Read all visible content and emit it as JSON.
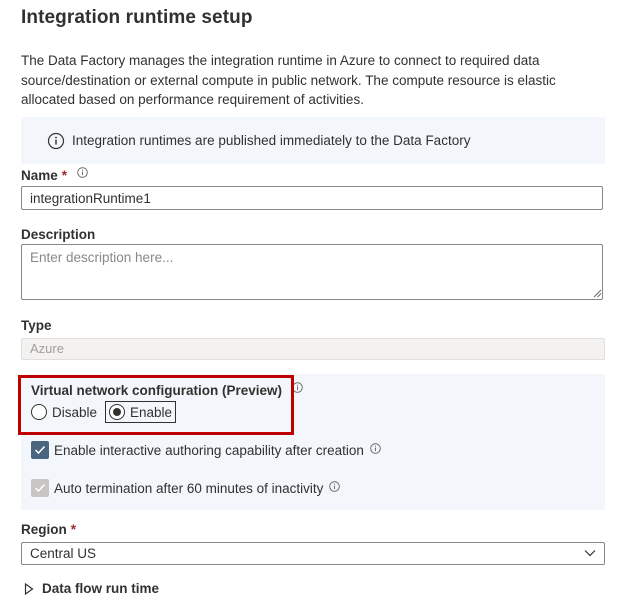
{
  "header": {
    "title": "Integration runtime setup"
  },
  "intro": {
    "text": "The Data Factory manages the integration runtime in Azure to connect to required data source/destination or external compute in public network. The compute resource is elastic allocated based on performance requirement of activities."
  },
  "info_banner": {
    "icon": "info-icon",
    "text": "Integration runtimes are published immediately to the Data Factory"
  },
  "form": {
    "name": {
      "label": "Name",
      "required_mark": "*",
      "value": "integrationRuntime1"
    },
    "description": {
      "label": "Description",
      "value": "",
      "placeholder": "Enter description here..."
    },
    "type": {
      "label": "Type",
      "value": "Azure"
    },
    "virtual_network": {
      "label": "Virtual network configuration (Preview)",
      "options": [
        {
          "label": "Disable",
          "selected": false
        },
        {
          "label": "Enable",
          "selected": true
        }
      ]
    },
    "interactive_authoring": {
      "label": "Enable interactive authoring capability after creation",
      "checked": true
    },
    "auto_termination": {
      "label": "Auto termination after 60 minutes of inactivity",
      "checked": true,
      "disabled": true
    },
    "region": {
      "label": "Region",
      "required_mark": "*",
      "value": "Central US"
    },
    "data_flow": {
      "label": "Data flow run time",
      "expanded": false
    }
  },
  "colors": {
    "highlight": "#c00000",
    "section_bg": "#f3f6fb",
    "checkbox_checked": "#4a6580",
    "checkbox_disabled": "#c8c6c4",
    "required": "#a4262c"
  }
}
